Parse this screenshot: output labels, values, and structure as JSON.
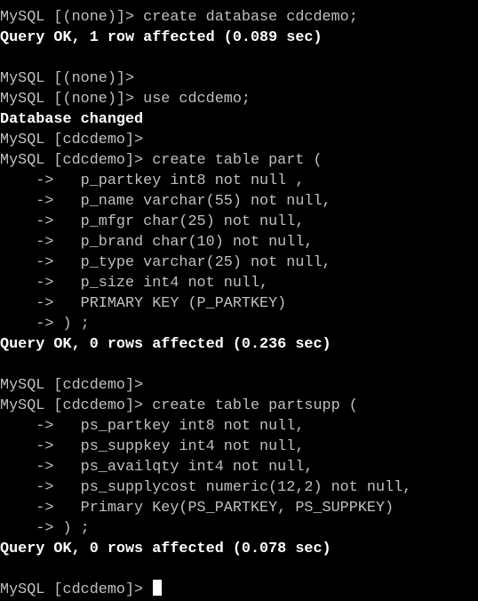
{
  "terminal": {
    "lines": [
      {
        "text": "MySQL [(none)]> create database cdcdemo;",
        "bold": false
      },
      {
        "text": "Query OK, 1 row affected (0.089 sec)",
        "bold": true
      },
      {
        "text": "",
        "bold": false
      },
      {
        "text": "MySQL [(none)]>",
        "bold": false
      },
      {
        "text": "MySQL [(none)]> use cdcdemo;",
        "bold": false
      },
      {
        "text": "Database changed",
        "bold": true
      },
      {
        "text": "MySQL [cdcdemo]>",
        "bold": false
      },
      {
        "text": "MySQL [cdcdemo]> create table part (",
        "bold": false
      },
      {
        "text": "    ->   p_partkey int8 not null ,",
        "bold": false
      },
      {
        "text": "    ->   p_name varchar(55) not null,",
        "bold": false
      },
      {
        "text": "    ->   p_mfgr char(25) not null,",
        "bold": false
      },
      {
        "text": "    ->   p_brand char(10) not null,",
        "bold": false
      },
      {
        "text": "    ->   p_type varchar(25) not null,",
        "bold": false
      },
      {
        "text": "    ->   p_size int4 not null,",
        "bold": false
      },
      {
        "text": "    ->   PRIMARY KEY (P_PARTKEY)",
        "bold": false
      },
      {
        "text": "    -> ) ;",
        "bold": false
      },
      {
        "text": "Query OK, 0 rows affected (0.236 sec)",
        "bold": true
      },
      {
        "text": "",
        "bold": false
      },
      {
        "text": "MySQL [cdcdemo]>",
        "bold": false
      },
      {
        "text": "MySQL [cdcdemo]> create table partsupp (",
        "bold": false
      },
      {
        "text": "    ->   ps_partkey int8 not null,",
        "bold": false
      },
      {
        "text": "    ->   ps_suppkey int4 not null,",
        "bold": false
      },
      {
        "text": "    ->   ps_availqty int4 not null,",
        "bold": false
      },
      {
        "text": "    ->   ps_supplycost numeric(12,2) not null,",
        "bold": false
      },
      {
        "text": "    ->   Primary Key(PS_PARTKEY, PS_SUPPKEY)",
        "bold": false
      },
      {
        "text": "    -> ) ;",
        "bold": false
      },
      {
        "text": "Query OK, 0 rows affected (0.078 sec)",
        "bold": true
      },
      {
        "text": "",
        "bold": false
      }
    ],
    "prompt": "MySQL [cdcdemo]> "
  }
}
